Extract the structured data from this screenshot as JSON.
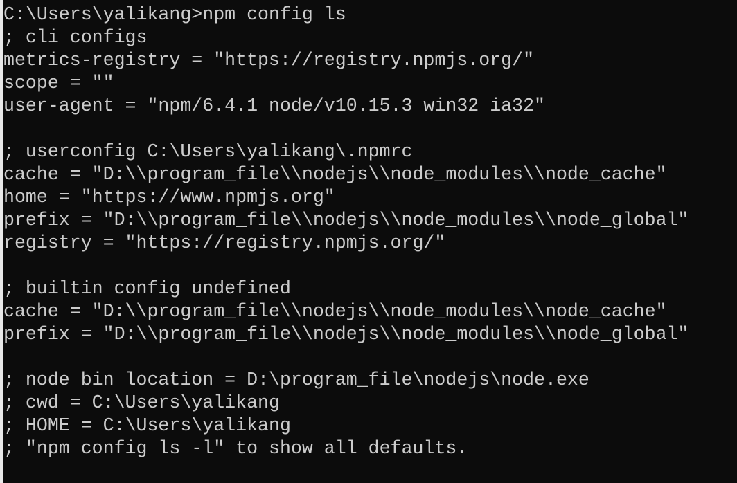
{
  "colors": {
    "background": "#0c0c0c",
    "foreground": "#cccccc"
  },
  "terminal": {
    "lines": [
      "C:\\Users\\yalikang>npm config ls",
      "; cli configs",
      "metrics-registry = \"https://registry.npmjs.org/\"",
      "scope = \"\"",
      "user-agent = \"npm/6.4.1 node/v10.15.3 win32 ia32\"",
      "",
      "; userconfig C:\\Users\\yalikang\\.npmrc",
      "cache = \"D:\\\\program_file\\\\nodejs\\\\node_modules\\\\node_cache\"",
      "home = \"https://www.npmjs.org\"",
      "prefix = \"D:\\\\program_file\\\\nodejs\\\\node_modules\\\\node_global\"",
      "registry = \"https://registry.npmjs.org/\"",
      "",
      "; builtin config undefined",
      "cache = \"D:\\\\program_file\\\\nodejs\\\\node_modules\\\\node_cache\"",
      "prefix = \"D:\\\\program_file\\\\nodejs\\\\node_modules\\\\node_global\"",
      "",
      "; node bin location = D:\\program_file\\nodejs\\node.exe",
      "; cwd = C:\\Users\\yalikang",
      "; HOME = C:\\Users\\yalikang",
      "; \"npm config ls -l\" to show all defaults."
    ]
  }
}
